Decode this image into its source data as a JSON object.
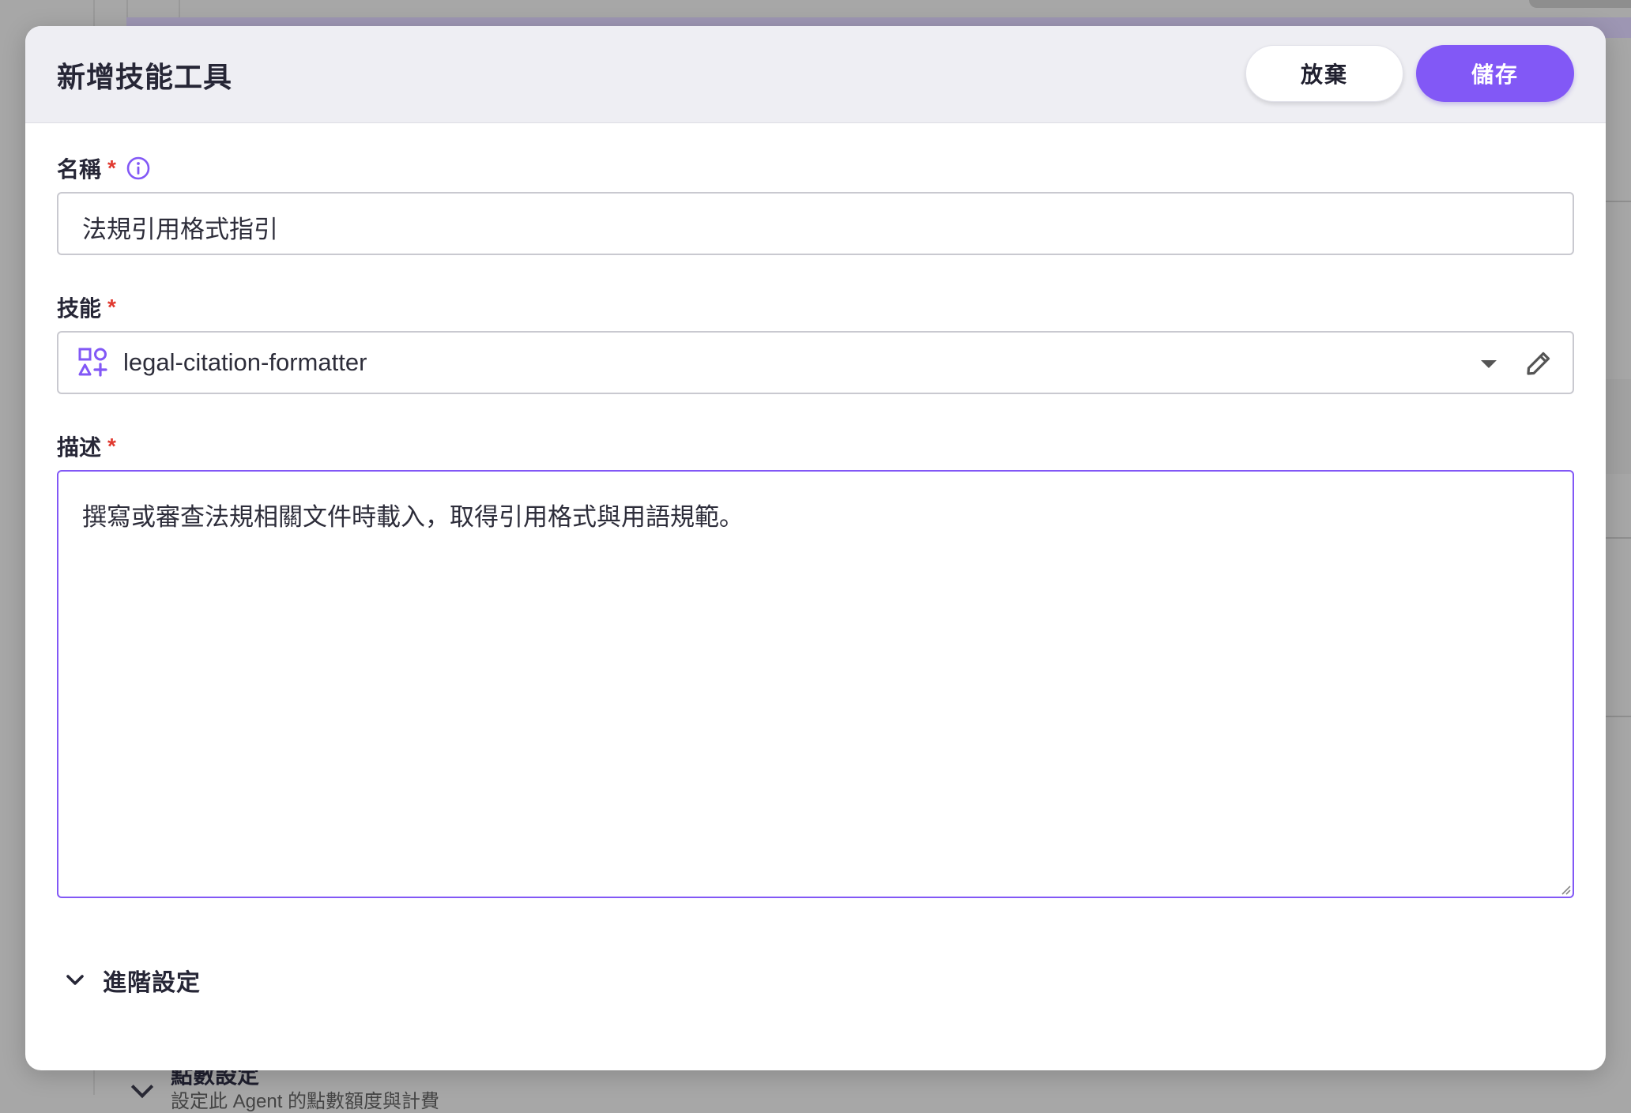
{
  "background": {
    "section_title": "點數設定",
    "section_subtitle": "設定此 Agent 的點數額度與計費"
  },
  "dialog": {
    "title": "新增技能工具",
    "discard_label": "放棄",
    "save_label": "儲存"
  },
  "fields": {
    "name": {
      "label": "名稱",
      "required_mark": "*",
      "value": "法規引用格式指引",
      "info_icon": "info-circle-icon"
    },
    "skill": {
      "label": "技能",
      "required_mark": "*",
      "value": "legal-citation-formatter",
      "icon": "shapes-icon"
    },
    "description": {
      "label": "描述",
      "required_mark": "*",
      "value": "撰寫或審查法規相關文件時載入，取得引用格式與用語規範。"
    }
  },
  "advanced": {
    "label": "進階設定"
  },
  "colors": {
    "accent": "#8258f6",
    "required": "#e0392f",
    "header_bg": "#eeeef3"
  }
}
